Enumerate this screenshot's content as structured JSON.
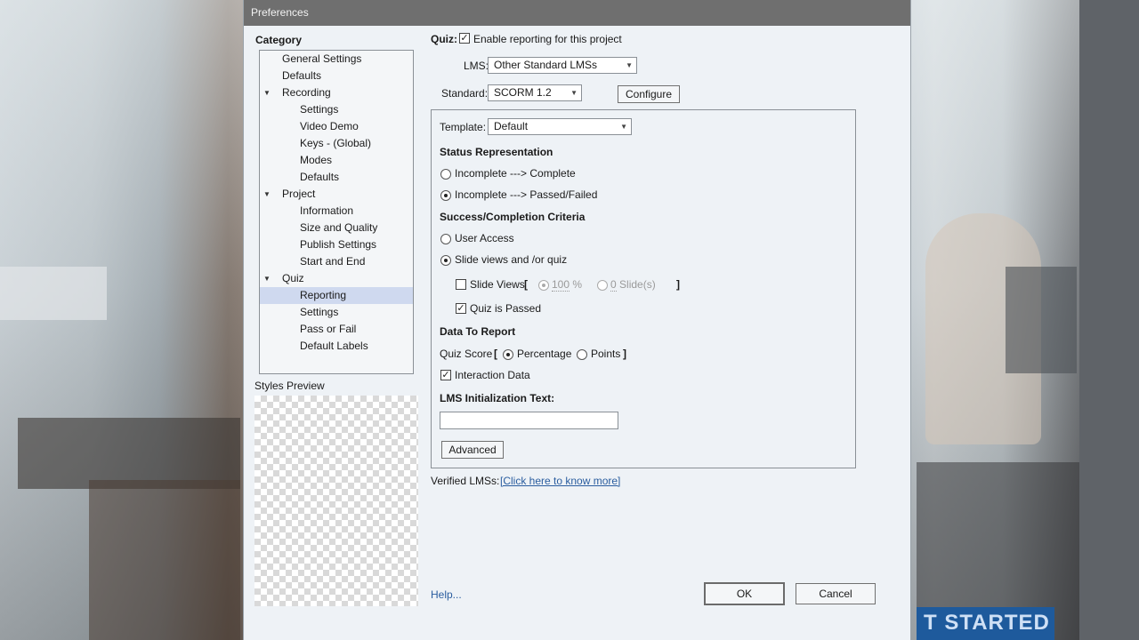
{
  "dialog": {
    "title": "Preferences"
  },
  "category": {
    "heading": "Category",
    "items": [
      {
        "label": "General Settings"
      },
      {
        "label": "Defaults"
      },
      {
        "label": "Recording"
      },
      {
        "label": "Settings"
      },
      {
        "label": "Video Demo"
      },
      {
        "label": "Keys - (Global)"
      },
      {
        "label": "Modes"
      },
      {
        "label": "Defaults"
      },
      {
        "label": "Project"
      },
      {
        "label": "Information"
      },
      {
        "label": "Size and Quality"
      },
      {
        "label": "Publish Settings"
      },
      {
        "label": "Start and End"
      },
      {
        "label": "Quiz"
      },
      {
        "label": "Reporting"
      },
      {
        "label": "Settings"
      },
      {
        "label": "Pass or Fail"
      },
      {
        "label": "Default Labels"
      }
    ],
    "expand_arrow": "▼"
  },
  "styles_preview": {
    "label": "Styles Preview"
  },
  "quiz": {
    "label": "Quiz:",
    "enable_reporting": "Enable reporting for this project",
    "enable_checked": true
  },
  "lms": {
    "label": "LMS:",
    "value": "Other Standard LMSs"
  },
  "standard": {
    "label": "Standard:",
    "value": "SCORM 1.2",
    "configure": "Configure"
  },
  "template": {
    "label": "Template:",
    "value": "Default"
  },
  "status": {
    "heading": "Status Representation",
    "opt1": "Incomplete ---> Complete",
    "opt2": "Incomplete ---> Passed/Failed",
    "selected": 2
  },
  "success": {
    "heading": "Success/Completion Criteria",
    "user_access": "User Access",
    "slide_views_quiz": "Slide views and /or quiz",
    "slide_views": "Slide Views",
    "bracket_open": "[",
    "bracket_close": "]",
    "percent_value": "100",
    "percent_unit": "%",
    "slides_value": "0",
    "slides_unit": "Slide(s)",
    "quiz_passed": "Quiz is Passed"
  },
  "report": {
    "heading": "Data To Report",
    "quiz_score": "Quiz Score",
    "bracket_open": "[",
    "bracket_close": "]",
    "percentage": "Percentage",
    "points": "Points",
    "interaction": "Interaction Data"
  },
  "lms_init": {
    "heading": "LMS Initialization Text:",
    "value": "",
    "advanced": "Advanced"
  },
  "verified": {
    "label": "Verified LMSs:",
    "link": "[Click here to know more]"
  },
  "footer": {
    "help": "Help...",
    "ok": "OK",
    "cancel": "Cancel"
  },
  "icons": {
    "check": "✓",
    "caret": "▼"
  },
  "background": {
    "banner": "T STARTED"
  }
}
